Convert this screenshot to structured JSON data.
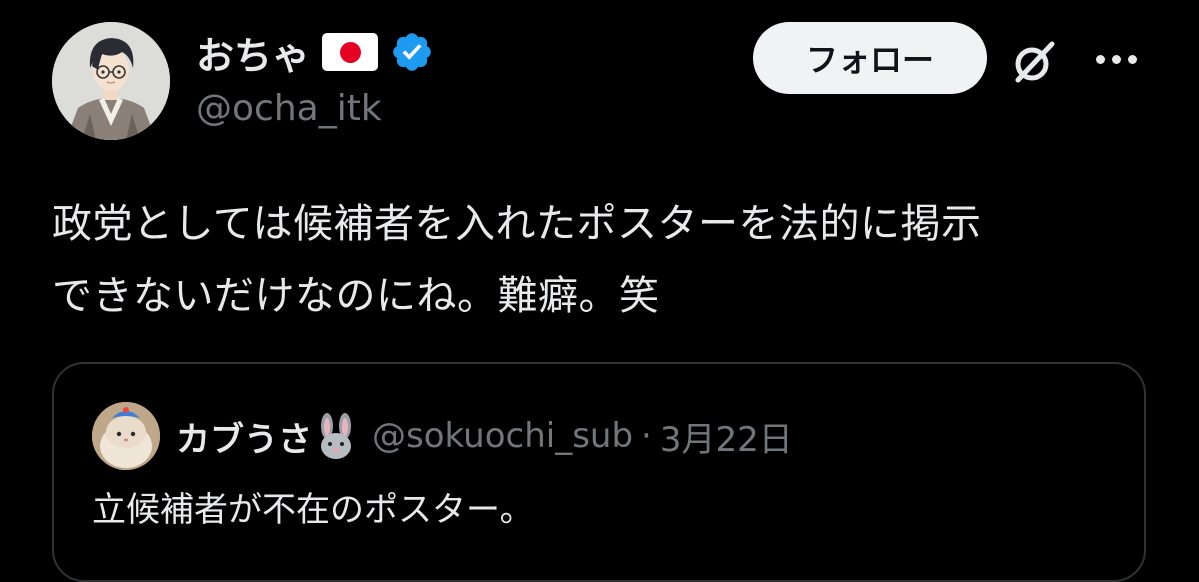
{
  "author": {
    "display_name": "おちゃ",
    "handle": "@ocha_itk",
    "flag_icon": "japan-flag-icon",
    "verified_color": "#1d9bf0"
  },
  "actions": {
    "follow_label": "フォロー"
  },
  "tweet": {
    "text_line1": "政党としては候補者を入れたポスターを法的に掲示",
    "text_line2": "できないだけなのにね。難癖。笑"
  },
  "quoted": {
    "display_name": "カブうさ",
    "name_emoji_icon": "rabbit-face-icon",
    "handle": "@sokuochi_sub",
    "separator": "·",
    "date": "3月22日",
    "text": "立候補者が不在のポスター。"
  },
  "colors": {
    "background": "#000000",
    "text_primary": "#e7e9ea",
    "text_secondary": "#71767b",
    "border": "#2f3336",
    "follow_bg": "#eff3f4"
  }
}
